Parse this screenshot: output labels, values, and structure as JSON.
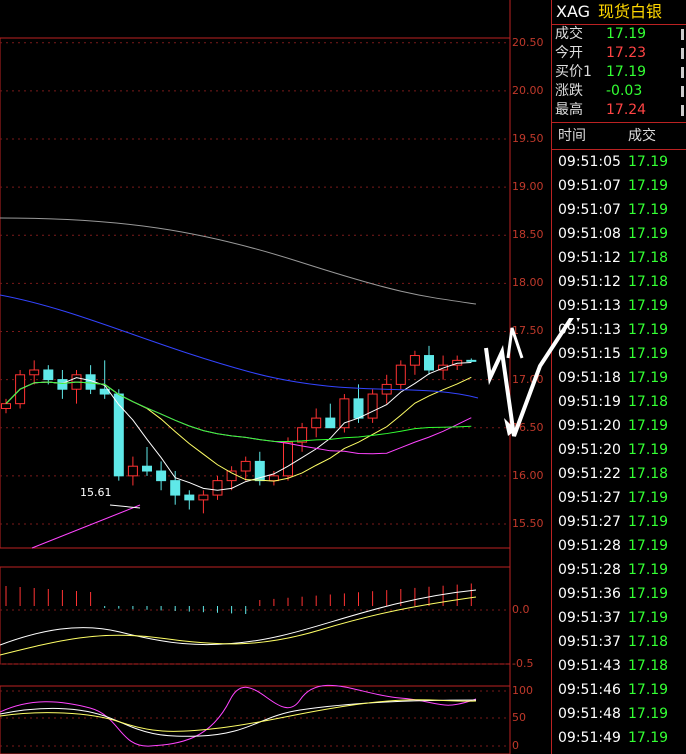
{
  "quote_panel": {
    "code": "XAG",
    "name": "现货白银",
    "rows": [
      {
        "label": "成交",
        "value": "17.19",
        "color": "#33ff33"
      },
      {
        "label": "今开",
        "value": "17.23",
        "color": "#ff4444"
      },
      {
        "label": "买价1",
        "value": "17.19",
        "color": "#33ff33"
      },
      {
        "label": "涨跌",
        "value": "-0.03",
        "color": "#33ff33"
      },
      {
        "label": "最高",
        "value": "17.24",
        "color": "#ff4444"
      }
    ]
  },
  "ticks": {
    "header_time": "时间",
    "header_price": "成交",
    "rows": [
      {
        "time": "09:51:05",
        "price": "17.19"
      },
      {
        "time": "09:51:07",
        "price": "17.19"
      },
      {
        "time": "09:51:07",
        "price": "17.19"
      },
      {
        "time": "09:51:08",
        "price": "17.19"
      },
      {
        "time": "09:51:12",
        "price": "17.18"
      },
      {
        "time": "09:51:12",
        "price": "17.18"
      },
      {
        "time": "09:51:13",
        "price": "17.19"
      },
      {
        "time": "09:51:13",
        "price": "17.19"
      },
      {
        "time": "09:51:15",
        "price": "17.19"
      },
      {
        "time": "09:51:18",
        "price": "17.19"
      },
      {
        "time": "09:51:19",
        "price": "17.18"
      },
      {
        "time": "09:51:20",
        "price": "17.19"
      },
      {
        "time": "09:51:20",
        "price": "17.19"
      },
      {
        "time": "09:51:22",
        "price": "17.18"
      },
      {
        "time": "09:51:27",
        "price": "17.19"
      },
      {
        "time": "09:51:27",
        "price": "17.19"
      },
      {
        "time": "09:51:28",
        "price": "17.19"
      },
      {
        "time": "09:51:28",
        "price": "17.19"
      },
      {
        "time": "09:51:36",
        "price": "17.19"
      },
      {
        "time": "09:51:37",
        "price": "17.19"
      },
      {
        "time": "09:51:37",
        "price": "17.18"
      },
      {
        "time": "09:51:43",
        "price": "17.18"
      },
      {
        "time": "09:51:46",
        "price": "17.19"
      },
      {
        "time": "09:51:48",
        "price": "17.19"
      },
      {
        "time": "09:51:49",
        "price": "17.19"
      }
    ]
  },
  "chart_data": {
    "type": "candlestick",
    "y_ticks": [
      "20.50",
      "20.00",
      "19.50",
      "19.00",
      "18.50",
      "18.00",
      "17.50",
      "17.00",
      "16.50",
      "16.00",
      "15.50"
    ],
    "ylim": [
      15.25,
      20.55
    ],
    "low_label": "15.61",
    "macd_ticks": [
      "0.0",
      "-0.5"
    ],
    "kdj_ticks": [
      "100",
      "50",
      "0"
    ],
    "candles": [
      {
        "o": 16.7,
        "h": 16.8,
        "l": 16.65,
        "c": 16.75
      },
      {
        "o": 16.75,
        "h": 17.1,
        "l": 16.7,
        "c": 17.05
      },
      {
        "o": 17.05,
        "h": 17.2,
        "l": 16.95,
        "c": 17.1
      },
      {
        "o": 17.1,
        "h": 17.15,
        "l": 16.95,
        "c": 17.0
      },
      {
        "o": 17.0,
        "h": 17.1,
        "l": 16.8,
        "c": 16.9
      },
      {
        "o": 16.9,
        "h": 17.1,
        "l": 16.75,
        "c": 17.05
      },
      {
        "o": 17.05,
        "h": 17.15,
        "l": 16.85,
        "c": 16.9
      },
      {
        "o": 16.9,
        "h": 17.2,
        "l": 16.8,
        "c": 16.85
      },
      {
        "o": 16.85,
        "h": 16.9,
        "l": 15.95,
        "c": 16.0
      },
      {
        "o": 16.0,
        "h": 16.2,
        "l": 15.9,
        "c": 16.1
      },
      {
        "o": 16.1,
        "h": 16.3,
        "l": 16.0,
        "c": 16.05
      },
      {
        "o": 16.05,
        "h": 16.15,
        "l": 15.85,
        "c": 15.95
      },
      {
        "o": 15.95,
        "h": 16.05,
        "l": 15.7,
        "c": 15.8
      },
      {
        "o": 15.8,
        "h": 15.85,
        "l": 15.65,
        "c": 15.75
      },
      {
        "o": 15.75,
        "h": 15.85,
        "l": 15.61,
        "c": 15.8
      },
      {
        "o": 15.8,
        "h": 16.0,
        "l": 15.75,
        "c": 15.95
      },
      {
        "o": 15.95,
        "h": 16.1,
        "l": 15.85,
        "c": 16.05
      },
      {
        "o": 16.05,
        "h": 16.2,
        "l": 15.95,
        "c": 16.15
      },
      {
        "o": 16.15,
        "h": 16.25,
        "l": 15.9,
        "c": 15.95
      },
      {
        "o": 15.95,
        "h": 16.05,
        "l": 15.9,
        "c": 16.0
      },
      {
        "o": 16.0,
        "h": 16.4,
        "l": 15.95,
        "c": 16.35
      },
      {
        "o": 16.35,
        "h": 16.55,
        "l": 16.25,
        "c": 16.5
      },
      {
        "o": 16.5,
        "h": 16.7,
        "l": 16.4,
        "c": 16.6
      },
      {
        "o": 16.6,
        "h": 16.75,
        "l": 16.5,
        "c": 16.5
      },
      {
        "o": 16.5,
        "h": 16.85,
        "l": 16.45,
        "c": 16.8
      },
      {
        "o": 16.8,
        "h": 16.95,
        "l": 16.55,
        "c": 16.6
      },
      {
        "o": 16.6,
        "h": 16.9,
        "l": 16.55,
        "c": 16.85
      },
      {
        "o": 16.85,
        "h": 17.05,
        "l": 16.75,
        "c": 16.95
      },
      {
        "o": 16.95,
        "h": 17.2,
        "l": 16.9,
        "c": 17.15
      },
      {
        "o": 17.15,
        "h": 17.3,
        "l": 17.05,
        "c": 17.25
      },
      {
        "o": 17.25,
        "h": 17.35,
        "l": 17.05,
        "c": 17.1
      },
      {
        "o": 17.1,
        "h": 17.25,
        "l": 17.0,
        "c": 17.15
      },
      {
        "o": 17.15,
        "h": 17.25,
        "l": 17.1,
        "c": 17.2
      },
      {
        "o": 17.2,
        "h": 17.22,
        "l": 17.18,
        "c": 17.19
      }
    ]
  }
}
